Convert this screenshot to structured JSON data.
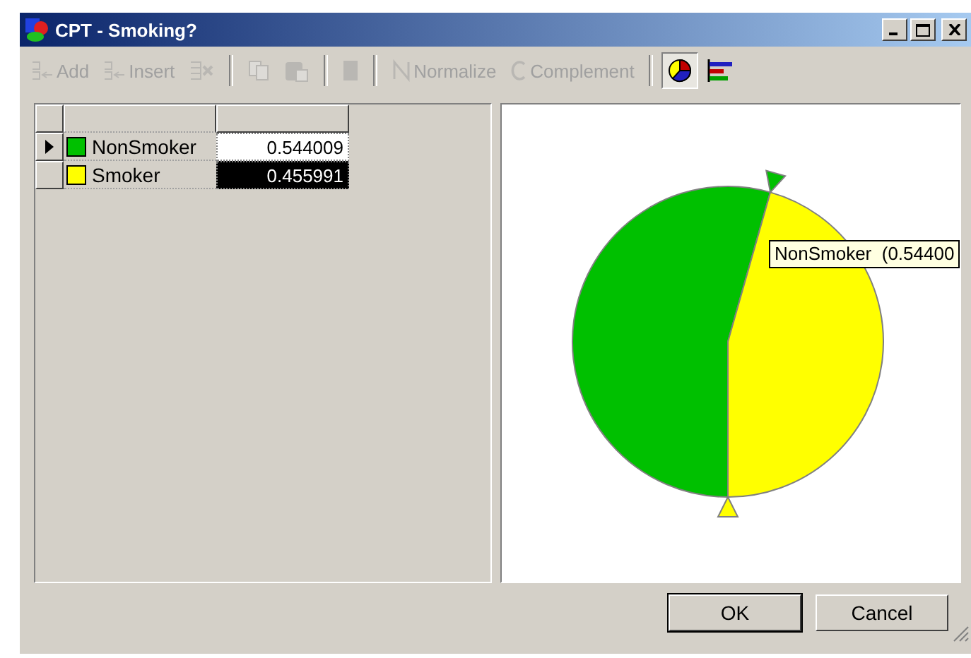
{
  "window": {
    "title": "CPT - Smoking?"
  },
  "toolbar": [
    {
      "kind": "text",
      "label": "Add",
      "disabled": true,
      "selected": false
    },
    {
      "kind": "text",
      "label": "Insert",
      "disabled": true,
      "selected": false
    },
    {
      "kind": "icon",
      "disabled": true,
      "selected": false
    },
    {
      "kind": "separator"
    },
    {
      "kind": "icon",
      "disabled": true,
      "selected": false
    },
    {
      "kind": "icon",
      "disabled": true,
      "selected": false
    },
    {
      "kind": "separator"
    },
    {
      "kind": "icon",
      "disabled": true,
      "selected": false
    },
    {
      "kind": "separator"
    },
    {
      "kind": "text",
      "label": "Normalize",
      "disabled": true,
      "selected": false
    },
    {
      "kind": "text",
      "label": "Complement",
      "disabled": true,
      "selected": false
    },
    {
      "kind": "separator"
    },
    {
      "kind": "icon",
      "disabled": false,
      "selected": true
    },
    {
      "kind": "icon",
      "disabled": false,
      "selected": false
    }
  ],
  "table": {
    "rows": [
      {
        "name": "NonSmoker",
        "value": "0.544009",
        "color": "#00c000",
        "selected": true,
        "value_highlighted": false
      },
      {
        "name": "Smoker",
        "value": "0.455991",
        "color": "#ffff00",
        "selected": false,
        "value_highlighted": true
      }
    ]
  },
  "tooltip": "NonSmoker  (0.54400",
  "buttons": [
    {
      "label": "OK",
      "default": true
    },
    {
      "label": "Cancel",
      "default": false
    }
  ]
}
